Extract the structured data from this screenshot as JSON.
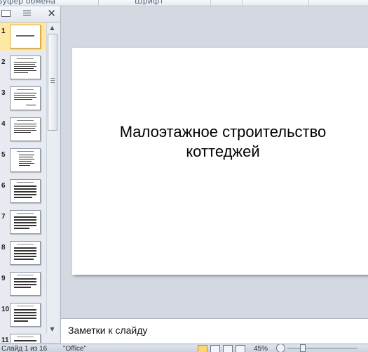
{
  "ribbon": {
    "groups": [
      "Буфер обмена",
      "Шрифт"
    ]
  },
  "left_pane": {
    "tab_slides_icon": "slides-thumbnail-icon",
    "tab_outline_icon": "outline-icon",
    "close_label": "✕",
    "thumbnails": [
      {
        "number": "1",
        "selected": true,
        "kind": "title"
      },
      {
        "number": "2",
        "selected": false,
        "kind": "text"
      },
      {
        "number": "3",
        "selected": false,
        "kind": "text"
      },
      {
        "number": "4",
        "selected": false,
        "kind": "text"
      },
      {
        "number": "5",
        "selected": false,
        "kind": "text"
      },
      {
        "number": "6",
        "selected": false,
        "kind": "text"
      },
      {
        "number": "7",
        "selected": false,
        "kind": "text"
      },
      {
        "number": "8",
        "selected": false,
        "kind": "text"
      },
      {
        "number": "9",
        "selected": false,
        "kind": "text"
      },
      {
        "number": "10",
        "selected": false,
        "kind": "text"
      },
      {
        "number": "11",
        "selected": false,
        "kind": "text"
      }
    ],
    "scroll_up_icon": "▲",
    "scroll_down_icon": "▼"
  },
  "slide": {
    "title_line1": "Малоэтажное строительство",
    "title_line2": "коттеджей"
  },
  "notes": {
    "placeholder": "Заметки к слайду"
  },
  "status": {
    "slide_info": "Слайд 1 из 16",
    "theme": "\"Office\"",
    "zoom": "45%"
  },
  "colors": {
    "selected_thumb": "#fde8a4",
    "workspace": "#d4d9e1"
  }
}
